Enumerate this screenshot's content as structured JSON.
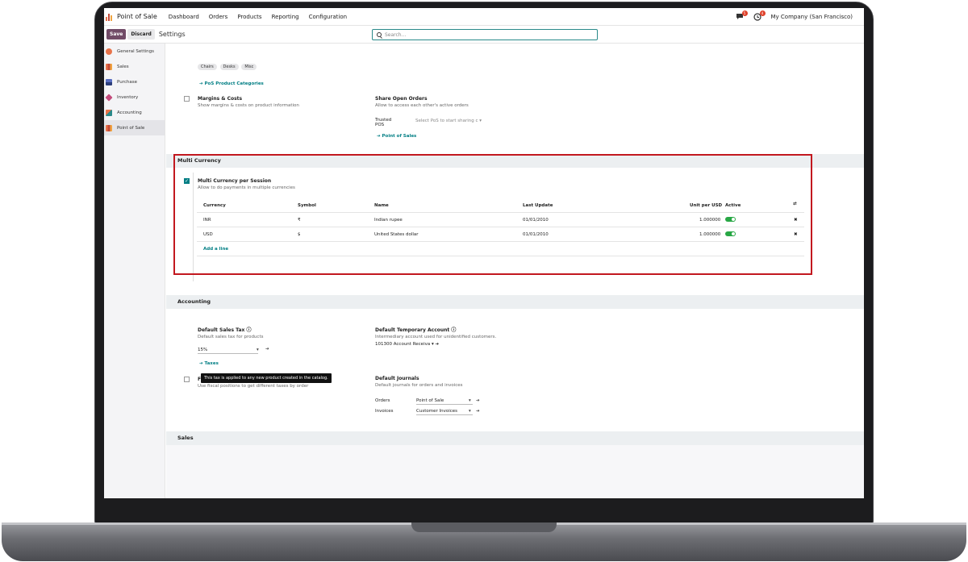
{
  "app": {
    "name": "Point of Sale",
    "menus": [
      "Dashboard",
      "Orders",
      "Products",
      "Reporting",
      "Configuration"
    ],
    "company": "My Company (San Francisco)",
    "badges": [
      "5",
      "4"
    ]
  },
  "control_panel": {
    "save_label": "Save",
    "discard_label": "Discard",
    "title": "Settings",
    "search_placeholder": "Search..."
  },
  "sidebar": {
    "items": [
      {
        "label": "General Settings",
        "color": "#e8734a"
      },
      {
        "label": "Sales",
        "color": "#e8734a"
      },
      {
        "label": "Purchase",
        "color": "#5a6fc2"
      },
      {
        "label": "Inventory",
        "color": "#c44b7c"
      },
      {
        "label": "Accounting",
        "color": "#e8734a"
      },
      {
        "label": "Point of Sale",
        "color": "#c44b3a"
      }
    ]
  },
  "categories": {
    "tags": [
      "Chairs",
      "Desks",
      "Misc"
    ],
    "link": "PoS Product Categories"
  },
  "margins": {
    "title": "Margins & Costs",
    "desc": "Show margins & costs on product information"
  },
  "share_orders": {
    "title": "Share Open Orders",
    "desc": "Allow to access each other's active orders",
    "trusted_label_1": "Trusted",
    "trusted_label_2": "POS",
    "trusted_placeholder": "Select PoS to start sharing c",
    "link": "Point of Sales"
  },
  "multi_currency": {
    "section": "Multi Currency",
    "title": "Multi Currency per Session",
    "desc": "Allow to do payments in multiple currencies",
    "columns": [
      "Currency",
      "Symbol",
      "Name",
      "Last Update",
      "Unit per USD",
      "Active"
    ],
    "rows": [
      {
        "currency": "INR",
        "symbol": "₹",
        "name": "Indian rupee",
        "last_update": "01/01/2010",
        "unit": "1.000000",
        "active": true
      },
      {
        "currency": "USD",
        "symbol": "$",
        "name": "United States dollar",
        "last_update": "01/01/2010",
        "unit": "1.000000",
        "active": true
      }
    ],
    "add_line": "Add a line"
  },
  "accounting": {
    "section": "Accounting",
    "sales_tax_title": "Default Sales Tax",
    "sales_tax_desc": "Default sales tax for products",
    "sales_tax_value": "15%",
    "taxes_link": "Taxes",
    "tooltip": "This tax is applied to any new product created in the catalog.",
    "fiscal_title_initial": "F",
    "fiscal_desc": "Use fiscal positions to get different taxes by order",
    "temp_account_title": "Default Temporary Account",
    "temp_account_desc": "Intermediary account used for unidentified customers.",
    "temp_account_value": "101300 Account Receiva",
    "journals_title": "Default Journals",
    "journals_desc": "Default journals for orders and invoices",
    "orders_label": "Orders",
    "orders_value": "Point of Sale",
    "invoices_label": "Invoices",
    "invoices_value": "Customer Invoices"
  },
  "sales": {
    "section": "Sales"
  }
}
